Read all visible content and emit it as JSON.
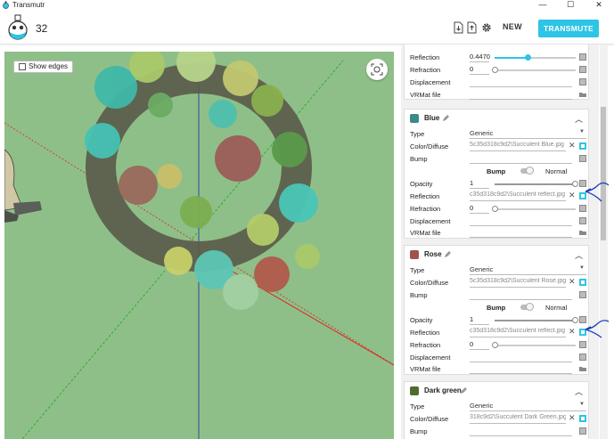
{
  "window": {
    "title": "Transmutr",
    "minimize": "—",
    "maximize": "☐",
    "close": "✕"
  },
  "header": {
    "counter": "32",
    "new_label": "NEW",
    "transmute_label": "TRANSMUTE"
  },
  "viewport": {
    "show_edges_label": "Show edges",
    "show_edges_checked": false
  },
  "materials_top": {
    "rows": [
      {
        "label": "Reflection",
        "value": "0.4470",
        "fill": 0.45
      },
      {
        "label": "Refraction",
        "value": "0",
        "fill": 0
      },
      {
        "label": "Displacement"
      },
      {
        "label": "VRMat file"
      }
    ]
  },
  "materials": [
    {
      "name": "Blue",
      "swatch": "#3a8a8a",
      "type_label": "Type",
      "type_value": "Generic",
      "color_label": "Color/Diffuse",
      "color_value": "5c35d318c9d2\\Succulent Blue.jpg",
      "bump_label": "Bump",
      "bump_toggle": {
        "left": "Bump",
        "right": "Normal"
      },
      "opacity_label": "Opacity",
      "opacity_value": "1",
      "reflection_label": "Reflection",
      "reflection_value": "c35d318c9d2\\Succulent reflect.jpg",
      "refraction_label": "Refraction",
      "refraction_value": "0",
      "displacement_label": "Displacement",
      "vrmat_label": "VRMat file"
    },
    {
      "name": "Rose",
      "swatch": "#a0524f",
      "type_label": "Type",
      "type_value": "Generic",
      "color_label": "Color/Diffuse",
      "color_value": "5c35d318c9d2\\Succulent Rose.jpg",
      "bump_label": "Bump",
      "bump_toggle": {
        "left": "Bump",
        "right": "Normal"
      },
      "opacity_label": "Opacity",
      "opacity_value": "1",
      "reflection_label": "Reflection",
      "reflection_value": "c35d318c9d2\\Succulent reflect.jpg",
      "refraction_label": "Refraction",
      "refraction_value": "0",
      "displacement_label": "Displacement",
      "vrmat_label": "VRMat file"
    },
    {
      "name": "Dark green",
      "swatch": "#4f6b2e",
      "type_label": "Type",
      "type_value": "Generic",
      "color_label": "Color/Diffuse",
      "color_value": "318c9d2\\Succulent Dark Green.jpg",
      "bump_label": "Bump"
    }
  ],
  "colors": {
    "accent": "#2ec4e6",
    "viewport_bg": "#8fbf88",
    "annotation": "#1a3dbd"
  }
}
